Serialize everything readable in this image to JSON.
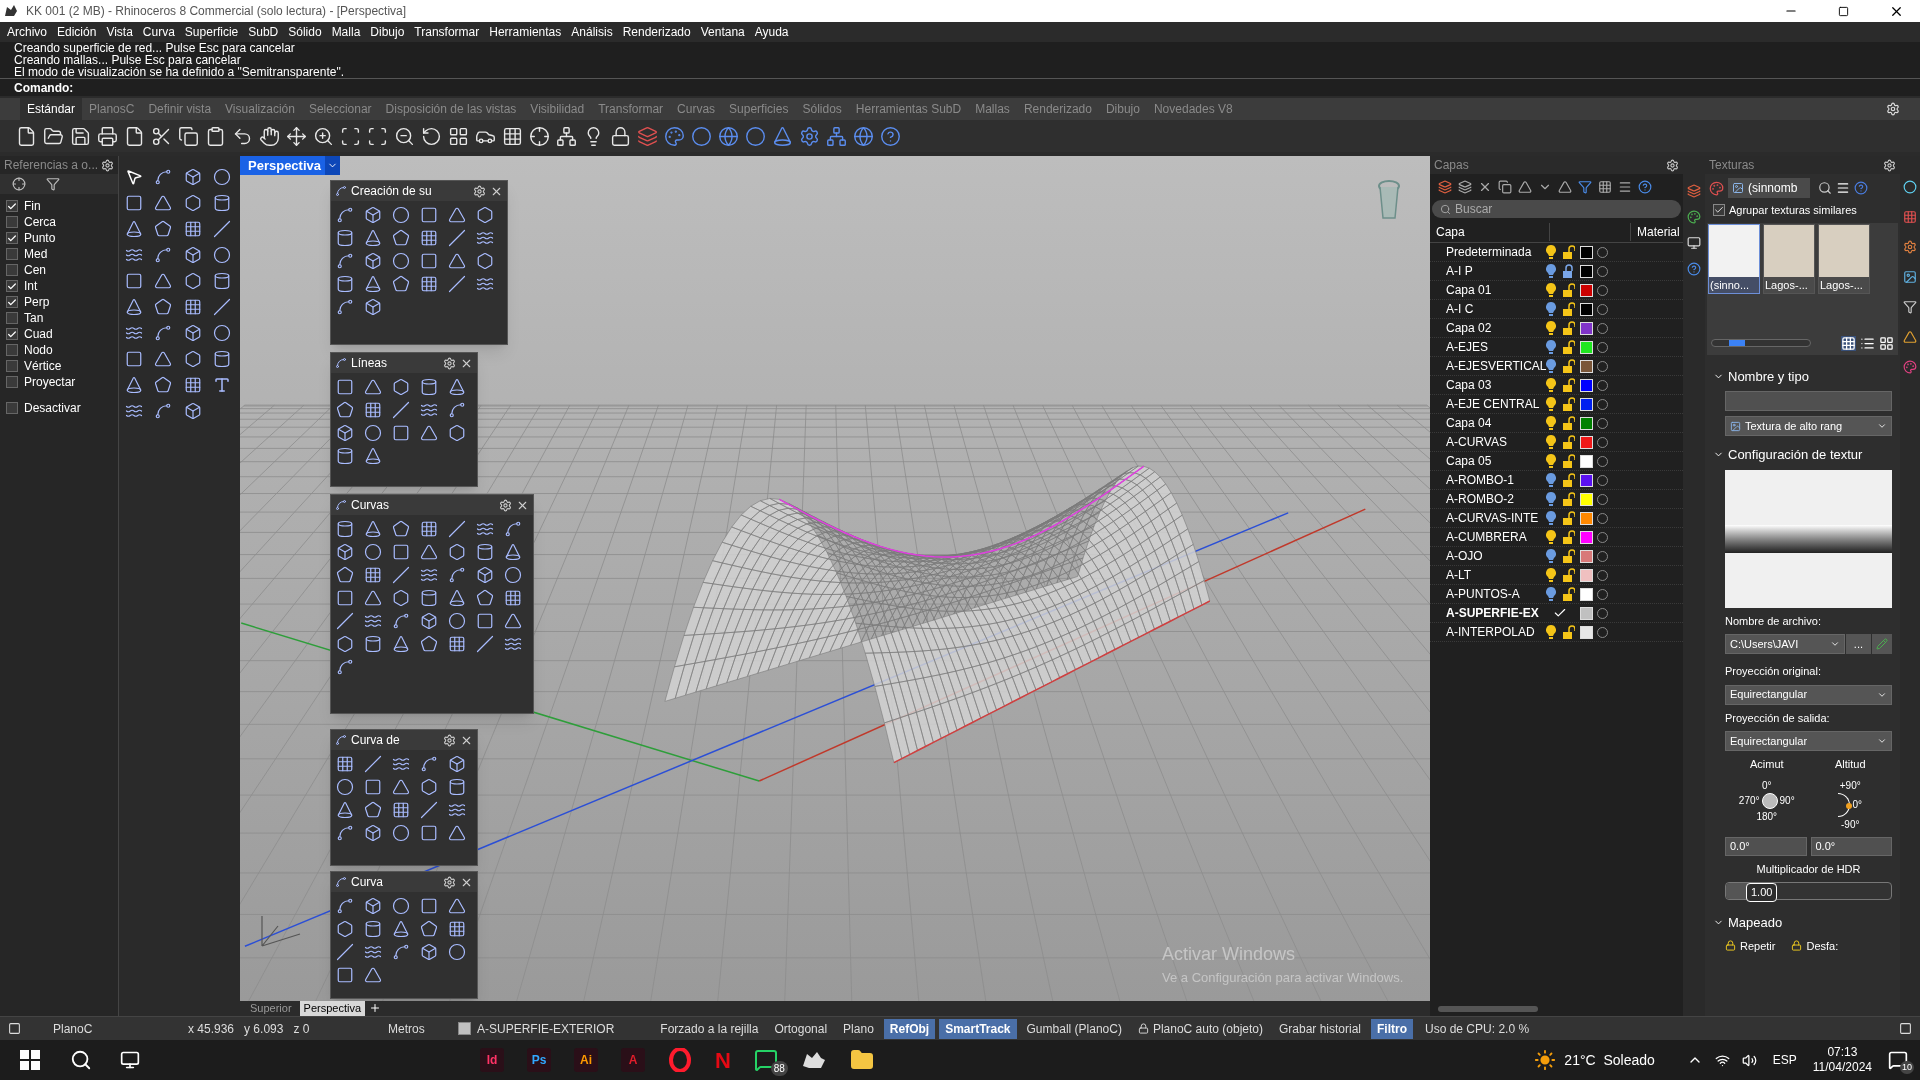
{
  "window": {
    "title": "KK 001 (2 MB) - Rhinoceros 8 Commercial (solo lectura) - [Perspectiva]"
  },
  "menu": [
    "Archivo",
    "Edición",
    "Vista",
    "Curva",
    "Superficie",
    "SubD",
    "Sólido",
    "Malla",
    "Dibujo",
    "Transformar",
    "Herramientas",
    "Análisis",
    "Renderizado",
    "Ventana",
    "Ayuda"
  ],
  "command_history": [
    "Creando superficie de red... Pulse Esc para cancelar",
    "Creando mallas... Pulse Esc para cancelar",
    "El modo de visualización se ha definido a \"Semitransparente\"."
  ],
  "command_prompt": "Comando:",
  "toolbar_tabs": [
    {
      "label": "Estándar",
      "selected": true
    },
    {
      "label": "PlanosC",
      "selected": false
    },
    {
      "label": "Definir vista",
      "selected": false
    },
    {
      "label": "Visualización",
      "selected": false
    },
    {
      "label": "Seleccionar",
      "selected": false
    },
    {
      "label": "Disposición de las vistas",
      "selected": false
    },
    {
      "label": "Visibilidad",
      "selected": false
    },
    {
      "label": "Transformar",
      "selected": false
    },
    {
      "label": "Curvas",
      "selected": false
    },
    {
      "label": "Superficies",
      "selected": false
    },
    {
      "label": "Sólidos",
      "selected": false
    },
    {
      "label": "Herramientas SubD",
      "selected": false
    },
    {
      "label": "Mallas",
      "selected": false
    },
    {
      "label": "Renderizado",
      "selected": false
    },
    {
      "label": "Dibujo",
      "selected": false
    },
    {
      "label": "Novedades V8",
      "selected": false
    }
  ],
  "osnap": {
    "title": "Referencias a o...",
    "items": [
      {
        "label": "Fin",
        "checked": true
      },
      {
        "label": "Cerca",
        "checked": false
      },
      {
        "label": "Punto",
        "checked": true
      },
      {
        "label": "Med",
        "checked": false
      },
      {
        "label": "Cen",
        "checked": false
      },
      {
        "label": "Int",
        "checked": true
      },
      {
        "label": "Perp",
        "checked": true
      },
      {
        "label": "Tan",
        "checked": false
      },
      {
        "label": "Cuad",
        "checked": true
      },
      {
        "label": "Nodo",
        "checked": false
      },
      {
        "label": "Vértice",
        "checked": false
      },
      {
        "label": "Proyectar",
        "checked": false
      }
    ],
    "disable": {
      "label": "Desactivar",
      "checked": false
    }
  },
  "viewport": {
    "title": "Perspectiva",
    "floating_toolbars": [
      {
        "title": "Creación de su"
      },
      {
        "title": "Líneas"
      },
      {
        "title": "Curvas"
      },
      {
        "title": "Curva de"
      },
      {
        "title": "Curva"
      }
    ],
    "tabs": [
      {
        "label": "Superior",
        "selected": false
      },
      {
        "label": "Perspectiva",
        "selected": true
      }
    ]
  },
  "os_notice": {
    "title": "Activar Windows",
    "text": "Ve a Configuración para activar Windows."
  },
  "layers": {
    "title": "Capas",
    "search": {
      "placeholder": "Buscar"
    },
    "columns": [
      "Capa",
      "Material"
    ],
    "rows": [
      {
        "name": "Predeterminada",
        "visible": true,
        "locked": false,
        "current": false,
        "color": "#000000"
      },
      {
        "name": "A-I P",
        "visible": false,
        "locked": true,
        "current": false,
        "color": "#000000"
      },
      {
        "name": "Capa 01",
        "visible": true,
        "locked": false,
        "current": false,
        "color": "#cc0000"
      },
      {
        "name": "A-I C",
        "visible": false,
        "locked": false,
        "current": false,
        "color": "#000000"
      },
      {
        "name": "Capa 02",
        "visible": true,
        "locked": false,
        "current": false,
        "color": "#8034c8"
      },
      {
        "name": "A-EJES",
        "visible": false,
        "locked": false,
        "current": false,
        "color": "#20e620"
      },
      {
        "name": "A-EJESVERTICAL",
        "visible": false,
        "locked": false,
        "current": false,
        "color": "#7a5638"
      },
      {
        "name": "Capa 03",
        "visible": true,
        "locked": false,
        "current": false,
        "color": "#0000ff"
      },
      {
        "name": "A-EJE CENTRAL",
        "visible": true,
        "locked": false,
        "current": false,
        "color": "#0020f0"
      },
      {
        "name": "Capa 04",
        "visible": true,
        "locked": false,
        "current": false,
        "color": "#008000"
      },
      {
        "name": "A-CURVAS",
        "visible": true,
        "locked": false,
        "current": false,
        "color": "#f01818"
      },
      {
        "name": "Capa 05",
        "visible": true,
        "locked": false,
        "current": false,
        "color": "#ffffff"
      },
      {
        "name": "A-ROMBO-1",
        "visible": false,
        "locked": false,
        "current": false,
        "color": "#5a10f0"
      },
      {
        "name": "A-ROMBO-2",
        "visible": false,
        "locked": false,
        "current": false,
        "color": "#ffff00"
      },
      {
        "name": "A-CURVAS-INTE",
        "visible": false,
        "locked": false,
        "current": false,
        "color": "#ff8800"
      },
      {
        "name": "A-CUMBRERA",
        "visible": true,
        "locked": false,
        "current": false,
        "color": "#ff00ff"
      },
      {
        "name": "A-OJO",
        "visible": false,
        "locked": false,
        "current": false,
        "color": "#d87878"
      },
      {
        "name": "A-LT",
        "visible": true,
        "locked": false,
        "current": false,
        "color": "#f0c0c0"
      },
      {
        "name": "A-PUNTOS-A",
        "visible": false,
        "locked": false,
        "current": false,
        "color": "#ffffff"
      },
      {
        "name": "A-SUPERFIE-EX",
        "current": true,
        "color": "#c0c0c0"
      },
      {
        "name": "A-INTERPOLAD",
        "visible": true,
        "locked": false,
        "current": false,
        "color": "#e6e6e6"
      }
    ]
  },
  "textures": {
    "title": "Texturas",
    "current": "(sinnomb",
    "group_similar": {
      "label": "Agrupar texturas similares",
      "checked": true
    },
    "thumbnails": [
      {
        "label": "(sinno...",
        "selected": true
      },
      {
        "label": "Lagos-...",
        "selected": false
      },
      {
        "label": "Lagos-...",
        "selected": false
      }
    ],
    "thumb_size": {
      "level": 0.2
    },
    "name_type": {
      "title": "Nombre y tipo",
      "type": "Textura de alto rang"
    },
    "settings": {
      "title": "Configuración de textur",
      "file_label": "Nombre de archivo:",
      "file": "C:\\Users\\JAVI",
      "browse": "...",
      "orig_label": "Proyección original:",
      "orig": "Equirectangular",
      "out_label": "Proyección de salida:",
      "out": "Equirectangular",
      "azimuth_label": "Acimut",
      "altitude_label": "Altitud",
      "azimuth_ticks": [
        "0°",
        "270°",
        "90°",
        "180°"
      ],
      "altitude_ticks": [
        "+90°",
        "0°",
        "-90°"
      ],
      "azimuth": "0.0°",
      "altitude": "0.0°",
      "hdr_label": "Multiplicador de HDR",
      "hdr": "1.00",
      "hdr_level": {
        "level": 0.3
      }
    },
    "mapping": {
      "title": "Mapeado",
      "options": [
        "Repetir",
        "Desfa:"
      ]
    }
  },
  "status_bar": {
    "plane": "PlanoC",
    "coords": "x 45.936   y 6.093   z 0",
    "units": "Metros",
    "layer": {
      "name": "A-SUPERFIE-EXTERIOR",
      "color": "#c0c0c0"
    },
    "items": [
      {
        "kind": "toggle",
        "label": "Forzado a la rejilla",
        "on": false
      },
      {
        "kind": "toggle",
        "label": "Ortogonal",
        "on": false
      },
      {
        "kind": "toggle",
        "label": "Plano",
        "on": false
      },
      {
        "kind": "toggle",
        "label": "RefObj",
        "on": true
      },
      {
        "kind": "toggle",
        "label": "SmartTrack",
        "on": true
      },
      {
        "kind": "toggle",
        "label": "Gumball (PlanoC)",
        "on": false
      },
      {
        "kind": "lock",
        "label": "PlanoC auto (objeto)",
        "on": false
      },
      {
        "kind": "toggle",
        "label": "Grabar historial",
        "on": false
      },
      {
        "kind": "toggle",
        "label": "Filtro",
        "on": true
      }
    ],
    "cpu": "Uso de CPU: 2.0 %"
  },
  "taskbar": {
    "apps": [
      {
        "kind": "tile",
        "label": "Id",
        "color": "#ff3366"
      },
      {
        "kind": "tile",
        "label": "Ps",
        "color": "#31a8ff"
      },
      {
        "kind": "tile",
        "label": "Ai",
        "color": "#ff9a00"
      },
      {
        "kind": "tile",
        "label": "A",
        "color": "#e11d2a"
      },
      {
        "kind": "opera"
      },
      {
        "kind": "letter",
        "label": "N",
        "color": "#e50914"
      },
      {
        "kind": "whatsapp",
        "badge": "88"
      },
      {
        "kind": "rhino"
      },
      {
        "kind": "folder"
      }
    ],
    "weather": "21°C  Soleado",
    "language": "ESP",
    "time": "07:13",
    "date": "11/04/2024",
    "notifications": "10"
  }
}
